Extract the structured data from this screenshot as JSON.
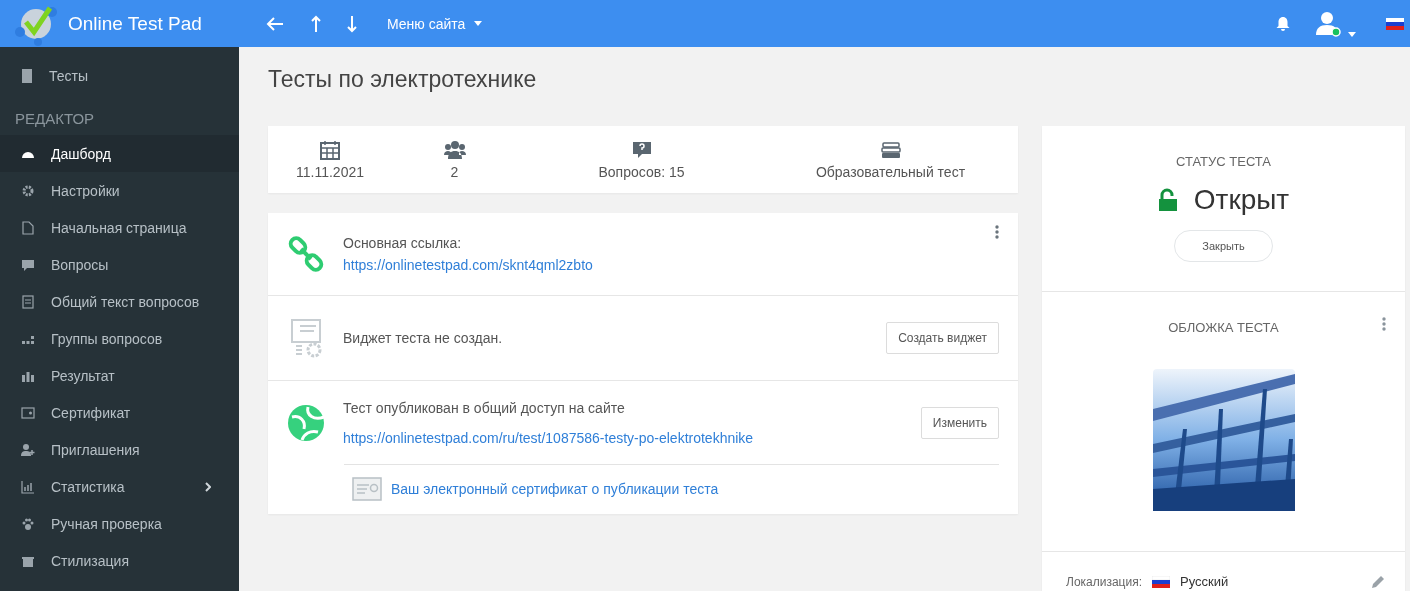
{
  "header": {
    "brand": "Online Test Pad",
    "site_menu": "Меню сайта"
  },
  "sidebar": {
    "top_item": {
      "label": "Тесты"
    },
    "section": "РЕДАКТОР",
    "items": [
      {
        "label": "Дашборд",
        "selected": true,
        "expandable": false
      },
      {
        "label": "Настройки",
        "selected": false,
        "expandable": false
      },
      {
        "label": "Начальная страница",
        "selected": false,
        "expandable": false
      },
      {
        "label": "Вопросы",
        "selected": false,
        "expandable": false
      },
      {
        "label": "Общий текст вопросов",
        "selected": false,
        "expandable": false
      },
      {
        "label": "Группы вопросов",
        "selected": false,
        "expandable": false
      },
      {
        "label": "Результат",
        "selected": false,
        "expandable": false
      },
      {
        "label": "Сертификат",
        "selected": false,
        "expandable": false
      },
      {
        "label": "Приглашения",
        "selected": false,
        "expandable": false
      },
      {
        "label": "Статистика",
        "selected": false,
        "expandable": true
      },
      {
        "label": "Ручная проверка",
        "selected": false,
        "expandable": false
      },
      {
        "label": "Стилизация",
        "selected": false,
        "expandable": false
      }
    ]
  },
  "page_title": "Тесты по электротехнике",
  "stats": [
    {
      "kind": "date",
      "text": "11.11.2021"
    },
    {
      "kind": "users",
      "text": "2"
    },
    {
      "kind": "questions",
      "text": "Вопросов: 15"
    },
    {
      "kind": "type",
      "text": "Образовательный тест"
    }
  ],
  "main_link": {
    "label": "Основная ссылка:",
    "url": "https://onlinetestpad.com/sknt4qml2zbto"
  },
  "widget": {
    "text": "Виджет теста не создан.",
    "button": "Создать виджет"
  },
  "publication": {
    "text": "Тест опубликован в общий доступ на сайте",
    "url": "https://onlinetestpad.com/ru/test/1087586-testy-po-elektrotekhnike",
    "button": "Изменить",
    "certificate_link": "Ваш электронный сертификат о публикации теста"
  },
  "status": {
    "title": "СТАТУС ТЕСТА",
    "value": "Открыт",
    "open": true,
    "button": "Закрыть"
  },
  "cover": {
    "title": "ОБЛОЖКА ТЕСТА",
    "kind": "picture"
  },
  "localization": {
    "label": "Локализация:",
    "value": "Русский"
  }
}
